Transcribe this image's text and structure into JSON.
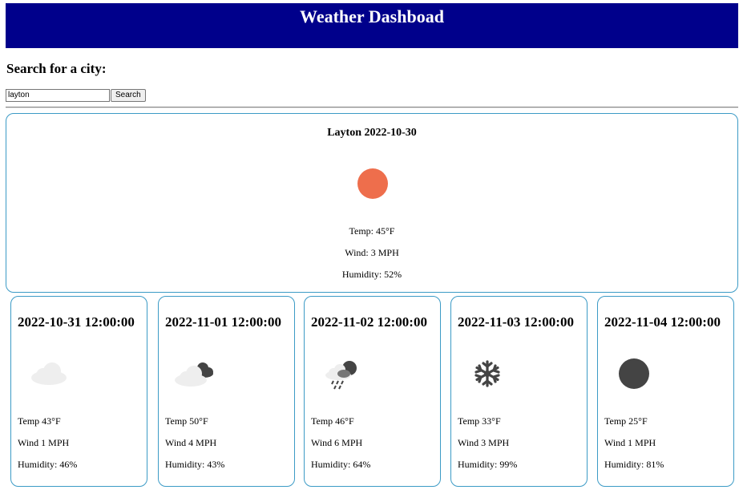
{
  "header": {
    "title": "Weather Dashboad"
  },
  "search": {
    "heading": "Search for a city:",
    "value": "layton",
    "button_label": "Search"
  },
  "current": {
    "title": "Layton 2022-10-30",
    "icon": "sun-icon",
    "temp": "Temp: 45°F",
    "wind": "Wind: 3 MPH",
    "humidity": "Humidity: 52%"
  },
  "forecast": [
    {
      "date": "2022-10-31 12:00:00",
      "icon": "cloud-icon",
      "temp": "Temp 43°F",
      "wind": "Wind 1 MPH",
      "humidity": "Humidity: 46%"
    },
    {
      "date": "2022-11-01 12:00:00",
      "icon": "dark-clouds-icon",
      "temp": "Temp 50°F",
      "wind": "Wind 4 MPH",
      "humidity": "Humidity: 43%"
    },
    {
      "date": "2022-11-02 12:00:00",
      "icon": "rain-clouds-icon",
      "temp": "Temp 46°F",
      "wind": "Wind 6 MPH",
      "humidity": "Humidity: 64%"
    },
    {
      "date": "2022-11-03 12:00:00",
      "icon": "snowflake-icon",
      "temp": "Temp 33°F",
      "wind": "Wind 3 MPH",
      "humidity": "Humidity: 99%"
    },
    {
      "date": "2022-11-04 12:00:00",
      "icon": "moon-icon",
      "temp": "Temp 25°F",
      "wind": "Wind 1 MPH",
      "humidity": "Humidity: 81%"
    }
  ],
  "colors": {
    "header_bg": "#00008b",
    "card_border": "#3c9bc6",
    "sun": "#ee6e4c",
    "dark_icon": "#444444",
    "light_cloud": "#eeeeee"
  }
}
